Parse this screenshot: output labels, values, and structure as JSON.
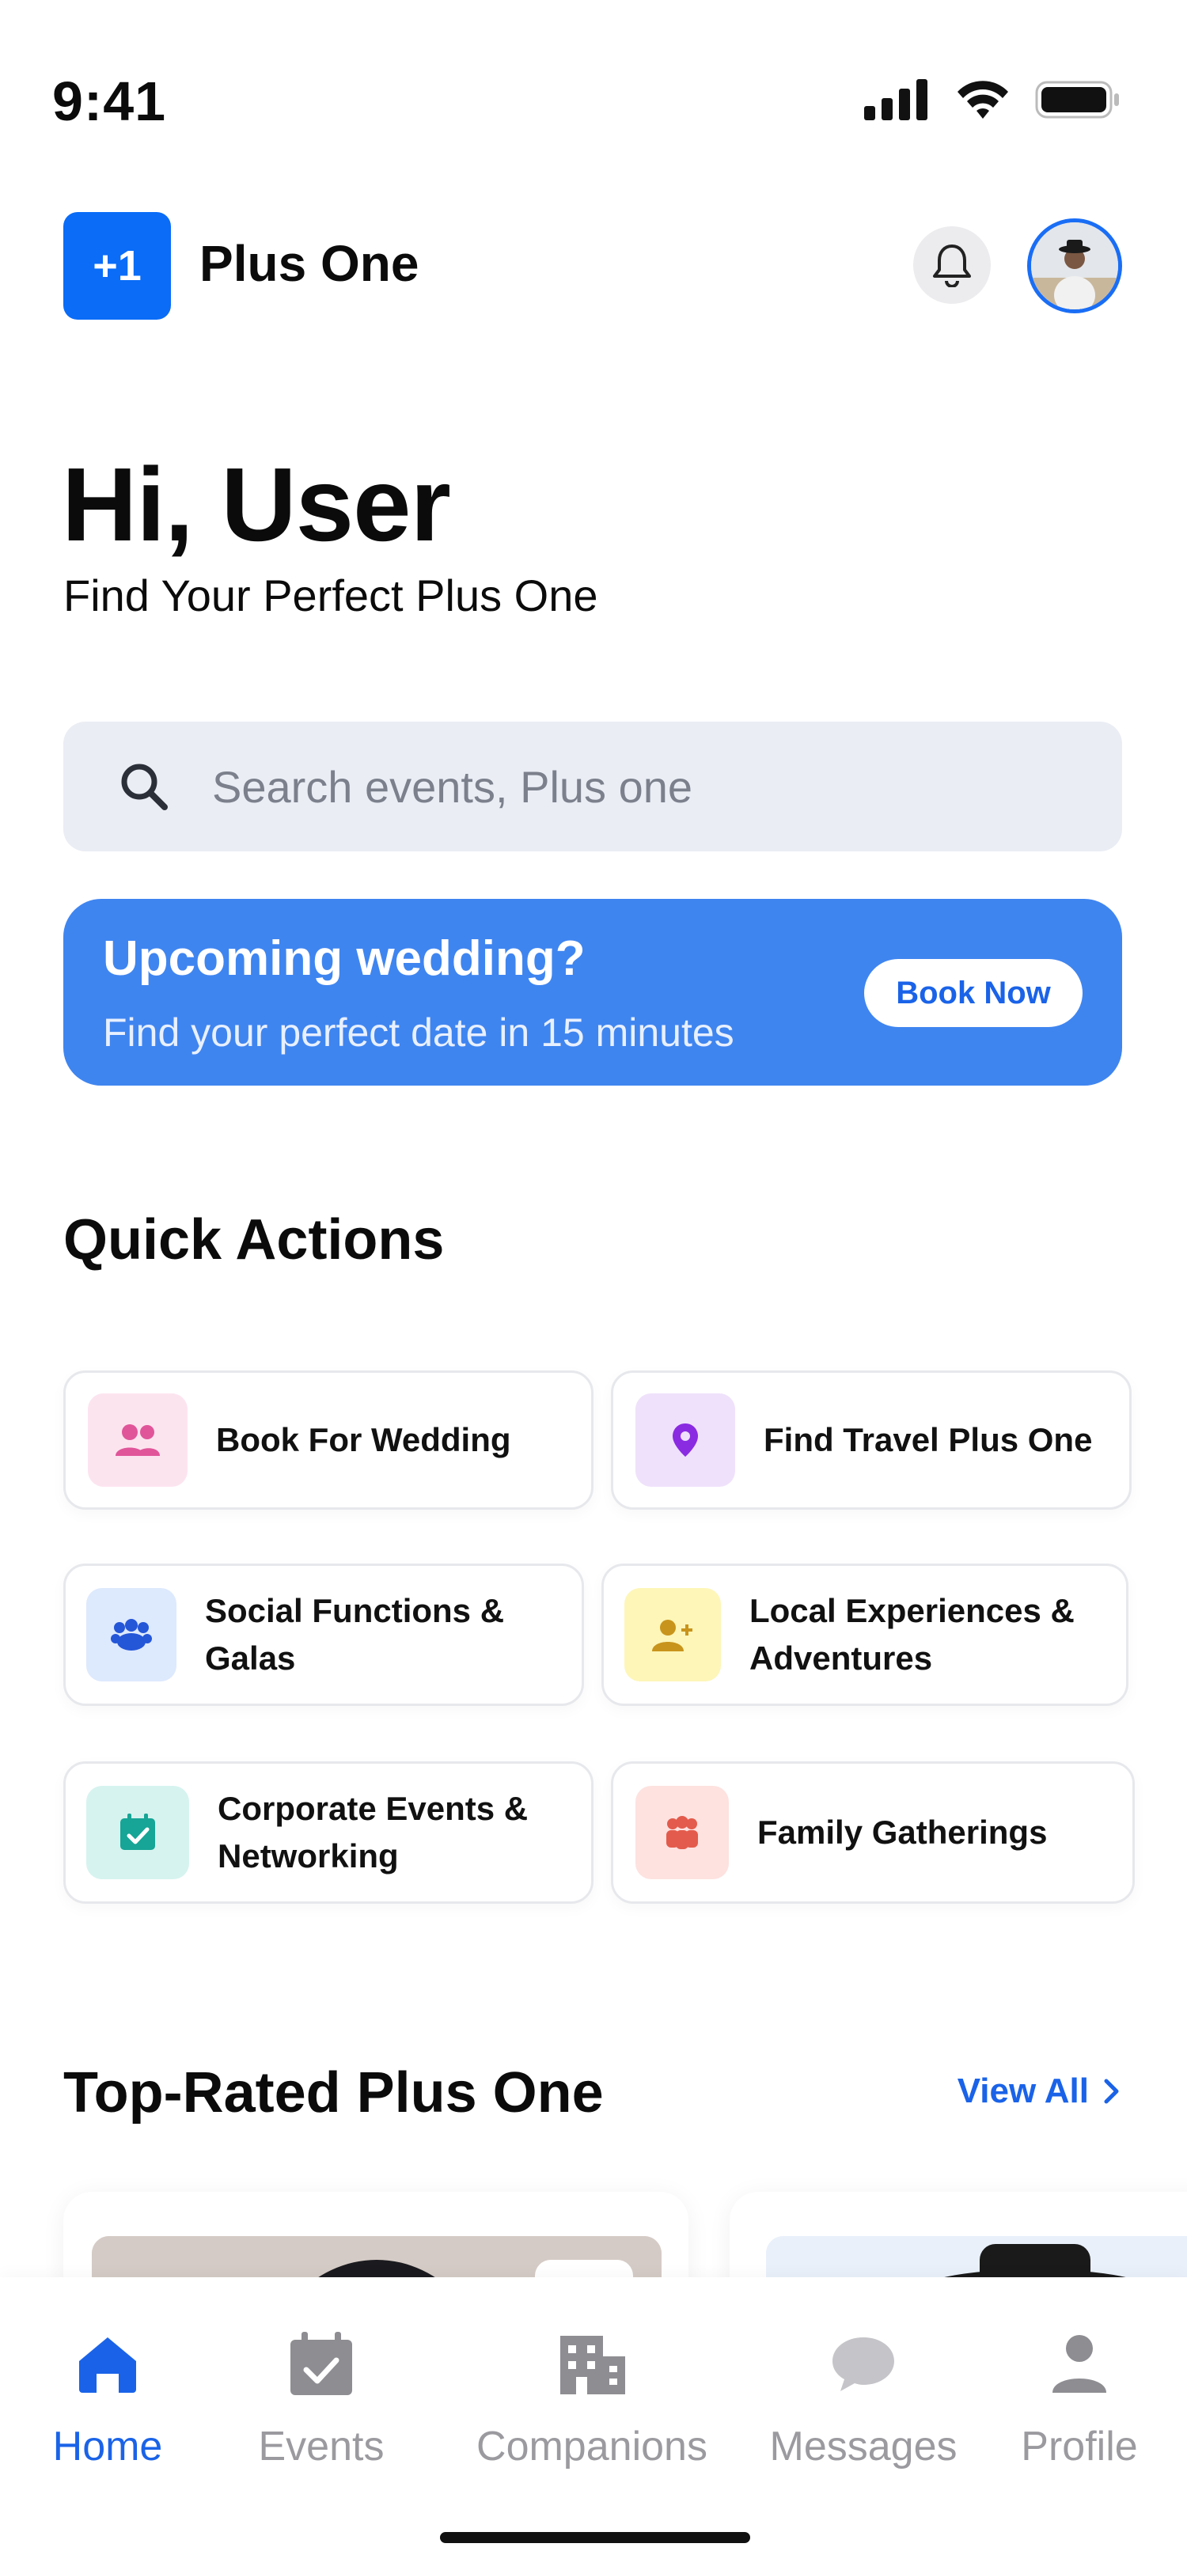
{
  "status_bar": {
    "time": "9:41"
  },
  "app": {
    "logo_text": "+1",
    "name": "Plus One"
  },
  "header": {
    "greeting": "Hi, User",
    "subtitle": "Find Your Perfect Plus One"
  },
  "search": {
    "placeholder": "Search events, Plus one"
  },
  "banner": {
    "title": "Upcoming wedding?",
    "subtitle": "Find your perfect date in 15 minutes",
    "button": "Book Now"
  },
  "quick_actions": {
    "title": "Quick Actions",
    "items": [
      {
        "label": "Book For Wedding",
        "icon": "people-icon"
      },
      {
        "label": "Find Travel Plus One",
        "icon": "location-pin-icon"
      },
      {
        "label": "Social Functions &\nGalas",
        "icon": "crowd-icon"
      },
      {
        "label": "Local Experiences &\nAdventures",
        "icon": "add-person-icon"
      },
      {
        "label": "Corporate Events &\nNetworking",
        "icon": "calendar-check-icon"
      },
      {
        "label": "Family Gatherings",
        "icon": "family-icon"
      }
    ]
  },
  "top_rated": {
    "title": "Top-Rated Plus One",
    "view_all": "View All"
  },
  "nav": {
    "items": [
      {
        "label": "Home",
        "icon": "home-icon",
        "active": true
      },
      {
        "label": "Events",
        "icon": "calendar-icon"
      },
      {
        "label": "Companions",
        "icon": "building-icon"
      },
      {
        "label": "Messages",
        "icon": "chat-bubble-icon"
      },
      {
        "label": "Profile",
        "icon": "person-icon"
      }
    ]
  },
  "colors": {
    "accent": "#0a6cf7",
    "banner": "#3f85f0",
    "nav_active": "#1a63e8",
    "nav_inactive": "#9a9a9f"
  }
}
